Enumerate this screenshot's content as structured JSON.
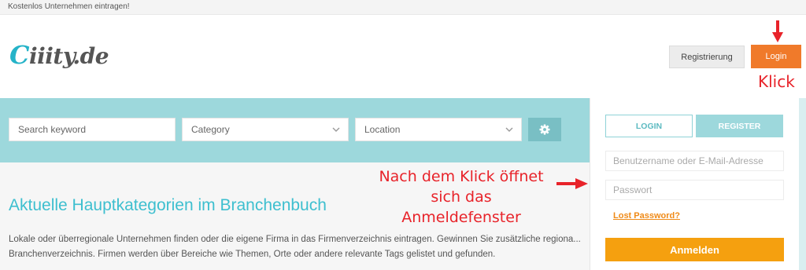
{
  "topbar": {
    "text": "Kostenlos Unternehmen eintragen!"
  },
  "header": {
    "logo_first": "C",
    "logo_rest": "iiity.de",
    "register_label": "Registrierung",
    "login_label": "Login"
  },
  "annotations": {
    "klick": "Klick",
    "note_line1": "Nach dem Klick öffnet",
    "note_line2": "sich das",
    "note_line3": "Anmeldefenster",
    "color": "#e8232a"
  },
  "search": {
    "keyword_placeholder": "Search keyword",
    "category_label": "Category",
    "location_label": "Location",
    "settings_icon": "gear-icon"
  },
  "main": {
    "heading": "Aktuelle Hauptkategorien im Branchenbuch",
    "paragraph": "Lokale oder überregionale Unternehmen finden oder die eigene Firma in das Firmenverzeichnis eintragen. Gewinnen Sie zusätzliche regiona... Branchenverzeichnis. Firmen werden über Bereiche wie Themen, Orte oder andere relevante Tags gelistet und gefunden."
  },
  "login_panel": {
    "tab_login": "LOGIN",
    "tab_register": "REGISTER",
    "username_placeholder": "Benutzername oder E-Mail-Adresse",
    "password_placeholder": "Passwort",
    "lost_password": "Lost Password?",
    "submit_label": "Anmelden"
  },
  "colors": {
    "accent_teal": "#9dd8dc",
    "login_orange": "#f07a2a",
    "submit_orange": "#f5a00f",
    "heading_teal": "#3dbfcf"
  }
}
